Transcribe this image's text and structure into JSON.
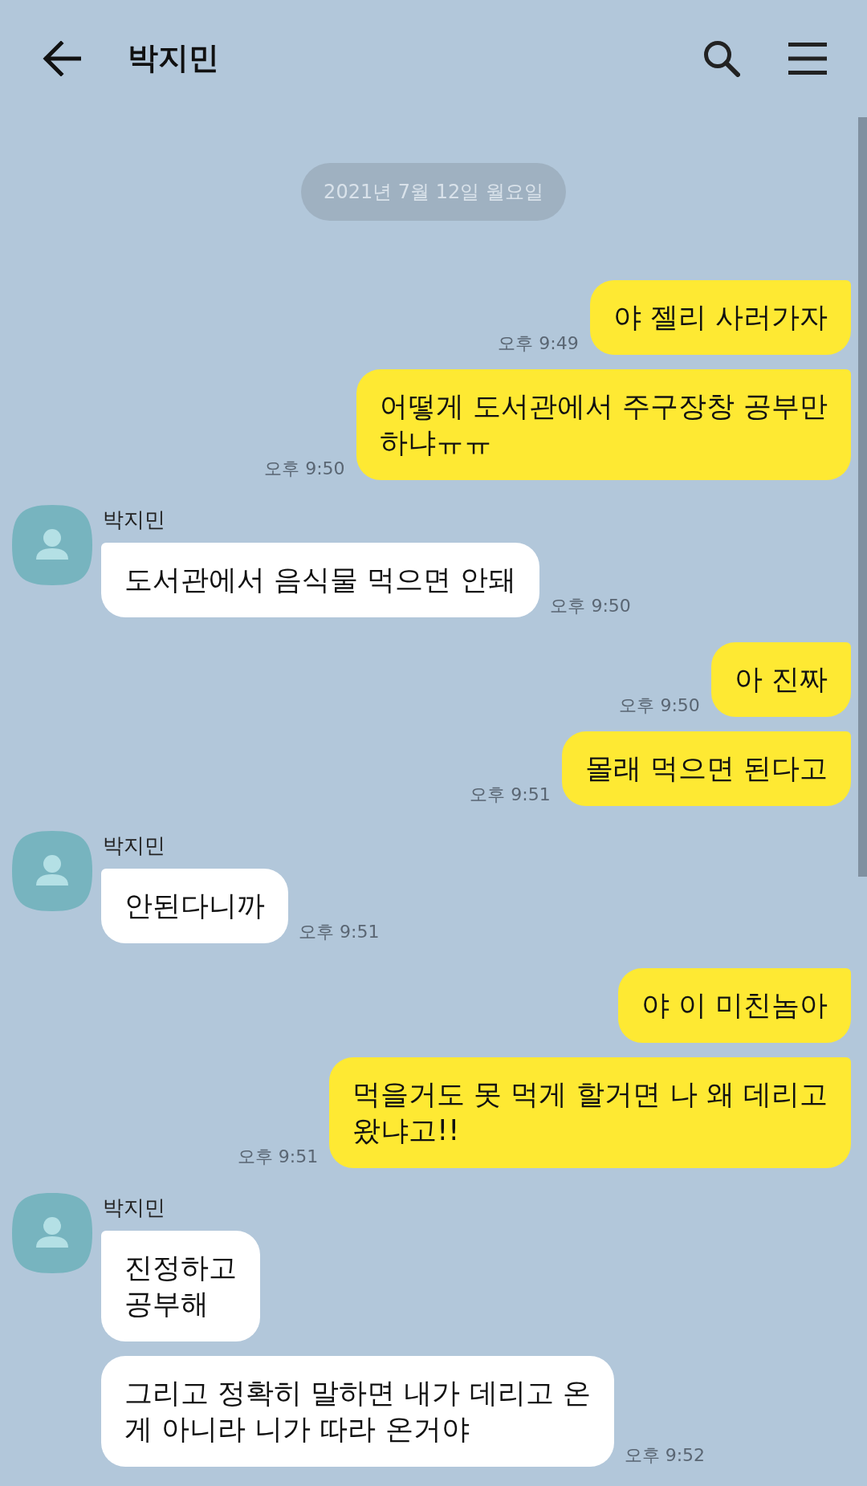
{
  "header": {
    "title": "박지민"
  },
  "date_divider": "2021년 7월 12일 월요일",
  "groups": [
    {
      "kind": "me",
      "messages": [
        {
          "text": "야 젤리 사러가자",
          "time": "오후 9:49"
        },
        {
          "text": "어떻게 도서관에서 주구장창 공부만\n하냐ㅠㅠ",
          "time": "오후 9:50"
        }
      ]
    },
    {
      "kind": "other",
      "sender": "박지민",
      "messages": [
        {
          "text": "도서관에서 음식물 먹으면 안돼",
          "time": "오후 9:50"
        }
      ]
    },
    {
      "kind": "me",
      "messages": [
        {
          "text": "아 진짜",
          "time": "오후 9:50"
        },
        {
          "text": "몰래 먹으면 된다고",
          "time": "오후 9:51"
        }
      ]
    },
    {
      "kind": "other",
      "sender": "박지민",
      "messages": [
        {
          "text": "안된다니까",
          "time": "오후 9:51"
        }
      ]
    },
    {
      "kind": "me",
      "messages": [
        {
          "text": "야 이 미친놈아"
        },
        {
          "text": "먹을거도 못 먹게 할거면 나 왜 데리고\n왔냐고!!",
          "time": "오후 9:51"
        }
      ]
    },
    {
      "kind": "other",
      "sender": "박지민",
      "messages": [
        {
          "text": "진정하고\n공부해"
        },
        {
          "text": "그리고 정확히 말하면 내가 데리고 온\n게 아니라 니가 따라 온거야",
          "time": "오후 9:52"
        }
      ]
    }
  ]
}
